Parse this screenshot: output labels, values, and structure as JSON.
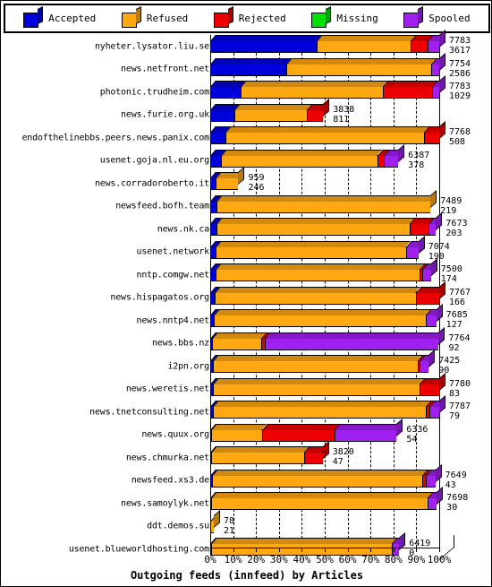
{
  "legend": {
    "items": [
      {
        "label": "Accepted",
        "color": "#0000dd",
        "icon": "cube-icon"
      },
      {
        "label": "Refused",
        "color": "#ffa812",
        "icon": "cube-icon"
      },
      {
        "label": "Rejected",
        "color": "#ee0000",
        "icon": "cube-icon"
      },
      {
        "label": "Missing",
        "color": "#00e000",
        "icon": "cube-icon"
      },
      {
        "label": "Spooled",
        "color": "#a020f0",
        "icon": "cube-icon"
      }
    ]
  },
  "axis": {
    "title": "Outgoing feeds (innfeed) by Articles",
    "ticks": [
      "0%",
      "10%",
      "20%",
      "30%",
      "40%",
      "50%",
      "60%",
      "70%",
      "80%",
      "90%",
      "100%"
    ]
  },
  "chart_data": {
    "type": "bar",
    "title": "Outgoing feeds (innfeed) by Articles",
    "xlabel": "Outgoing feeds (innfeed) by Articles",
    "ylabel": "",
    "orientation": "horizontal",
    "stacked": true,
    "normalized_percent": true,
    "xlim": [
      0,
      100
    ],
    "xticks": [
      0,
      10,
      20,
      30,
      40,
      50,
      60,
      70,
      80,
      90,
      100
    ],
    "grid": true,
    "legend_position": "top",
    "series_names": [
      "Accepted",
      "Refused",
      "Rejected",
      "Missing",
      "Spooled"
    ],
    "series_colors": [
      "#0000dd",
      "#ffa812",
      "#ee0000",
      "#00e000",
      "#a020f0"
    ],
    "categories": [
      "nyheter.lysator.liu.se",
      "news.netfront.net",
      "photonic.trudheim.com",
      "news.furie.org.uk",
      "endofthelinebbs.peers.news.panix.com",
      "usenet.goja.nl.eu.org",
      "news.corradoroberto.it",
      "newsfeed.bofh.team",
      "news.nk.ca",
      "usenet.network",
      "nntp.comgw.net",
      "news.hispagatos.org",
      "news.nntp4.net",
      "news.bbs.nz",
      "i2pn.org",
      "news.weretis.net",
      "news.tnetconsulting.net",
      "news.quux.org",
      "news.chmurka.net",
      "newsfeed.xs3.de",
      "news.samoylyk.net",
      "ddt.demos.su",
      "usenet.blueworldhosting.com"
    ],
    "rows": [
      {
        "label": "nyheter.lysator.liu.se",
        "total": 7783,
        "secondary": 3617,
        "bar_pct": 100.0,
        "segments": [
          46.5,
          41.0,
          7.5,
          0,
          5.0
        ]
      },
      {
        "label": "news.netfront.net",
        "total": 7754,
        "secondary": 2586,
        "bar_pct": 100.0,
        "segments": [
          33.3,
          63.2,
          0,
          0,
          3.5
        ]
      },
      {
        "label": "photonic.trudheim.com",
        "total": 7783,
        "secondary": 1029,
        "bar_pct": 100.0,
        "segments": [
          13.2,
          62.0,
          21.6,
          0,
          3.2
        ]
      },
      {
        "label": "news.furie.org.uk",
        "total": 3838,
        "secondary": 811,
        "bar_pct": 49.3,
        "segments": [
          21.1,
          64.2,
          14.7,
          0,
          0
        ]
      },
      {
        "label": "endofthelinebbs.peers.news.panix.com",
        "total": 7768,
        "secondary": 508,
        "bar_pct": 100.0,
        "segments": [
          6.5,
          87.0,
          6.5,
          0,
          0
        ]
      },
      {
        "label": "usenet.goja.nl.eu.org",
        "total": 6387,
        "secondary": 378,
        "bar_pct": 82.1,
        "segments": [
          5.9,
          83.0,
          3.3,
          0,
          7.8
        ]
      },
      {
        "label": "news.corradoroberto.it",
        "total": 959,
        "secondary": 246,
        "bar_pct": 12.3,
        "segments": [
          19.0,
          81.0,
          0,
          0,
          0
        ]
      },
      {
        "label": "newsfeed.bofh.team",
        "total": 7489,
        "secondary": 219,
        "bar_pct": 96.2,
        "segments": [
          2.9,
          97.1,
          0,
          0,
          0
        ]
      },
      {
        "label": "news.nk.ca",
        "total": 7673,
        "secondary": 203,
        "bar_pct": 98.6,
        "segments": [
          2.7,
          85.5,
          8.6,
          0,
          3.2
        ]
      },
      {
        "label": "usenet.network",
        "total": 7074,
        "secondary": 190,
        "bar_pct": 90.9,
        "segments": [
          2.7,
          91.3,
          0,
          0,
          6.0
        ]
      },
      {
        "label": "nntp.comgw.net",
        "total": 7500,
        "secondary": 174,
        "bar_pct": 96.4,
        "segments": [
          2.3,
          92.4,
          1.3,
          0,
          4.0
        ]
      },
      {
        "label": "news.hispagatos.org",
        "total": 7767,
        "secondary": 166,
        "bar_pct": 100.0,
        "segments": [
          2.1,
          87.6,
          10.3,
          0,
          0
        ]
      },
      {
        "label": "news.nntp4.net",
        "total": 7685,
        "secondary": 127,
        "bar_pct": 98.7,
        "segments": [
          1.7,
          93.8,
          0,
          0,
          4.5
        ]
      },
      {
        "label": "news.bbs.nz",
        "total": 7764,
        "secondary": 92,
        "bar_pct": 99.8,
        "segments": [
          0.6,
          21.7,
          1.7,
          0,
          76.0
        ]
      },
      {
        "label": "i2pn.org",
        "total": 7425,
        "secondary": 90,
        "bar_pct": 95.4,
        "segments": [
          1.1,
          94.0,
          0.9,
          0,
          4.0
        ]
      },
      {
        "label": "news.weretis.net",
        "total": 7780,
        "secondary": 83,
        "bar_pct": 100.0,
        "segments": [
          1.0,
          90.5,
          8.5,
          0,
          0
        ]
      },
      {
        "label": "news.tnetconsulting.net",
        "total": 7787,
        "secondary": 79,
        "bar_pct": 100.0,
        "segments": [
          1.0,
          93.0,
          1.7,
          0,
          4.3
        ]
      },
      {
        "label": "news.quux.org",
        "total": 6336,
        "secondary": 54,
        "bar_pct": 81.4,
        "segments": [
          0.6,
          27.0,
          39.0,
          0,
          33.4
        ]
      },
      {
        "label": "news.chmurka.net",
        "total": 3820,
        "secondary": 47,
        "bar_pct": 49.1,
        "segments": [
          0.8,
          83.0,
          16.2,
          0,
          0
        ]
      },
      {
        "label": "newsfeed.xs3.de",
        "total": 7649,
        "secondary": 43,
        "bar_pct": 98.3,
        "segments": [
          0.6,
          93.4,
          1.6,
          0,
          4.4
        ]
      },
      {
        "label": "news.samoylyk.net",
        "total": 7698,
        "secondary": 30,
        "bar_pct": 98.9,
        "segments": [
          0.5,
          95.5,
          0,
          0,
          4.0
        ]
      },
      {
        "label": "ddt.demos.su",
        "total": 78,
        "secondary": 21,
        "bar_pct": 1.0,
        "segments": [
          0,
          100,
          0,
          0,
          0
        ]
      },
      {
        "label": "usenet.blueworldhosting.com",
        "total": 6419,
        "secondary": 0,
        "bar_pct": 82.5,
        "segments": [
          0.3,
          96.0,
          0,
          0,
          3.7
        ]
      }
    ]
  }
}
